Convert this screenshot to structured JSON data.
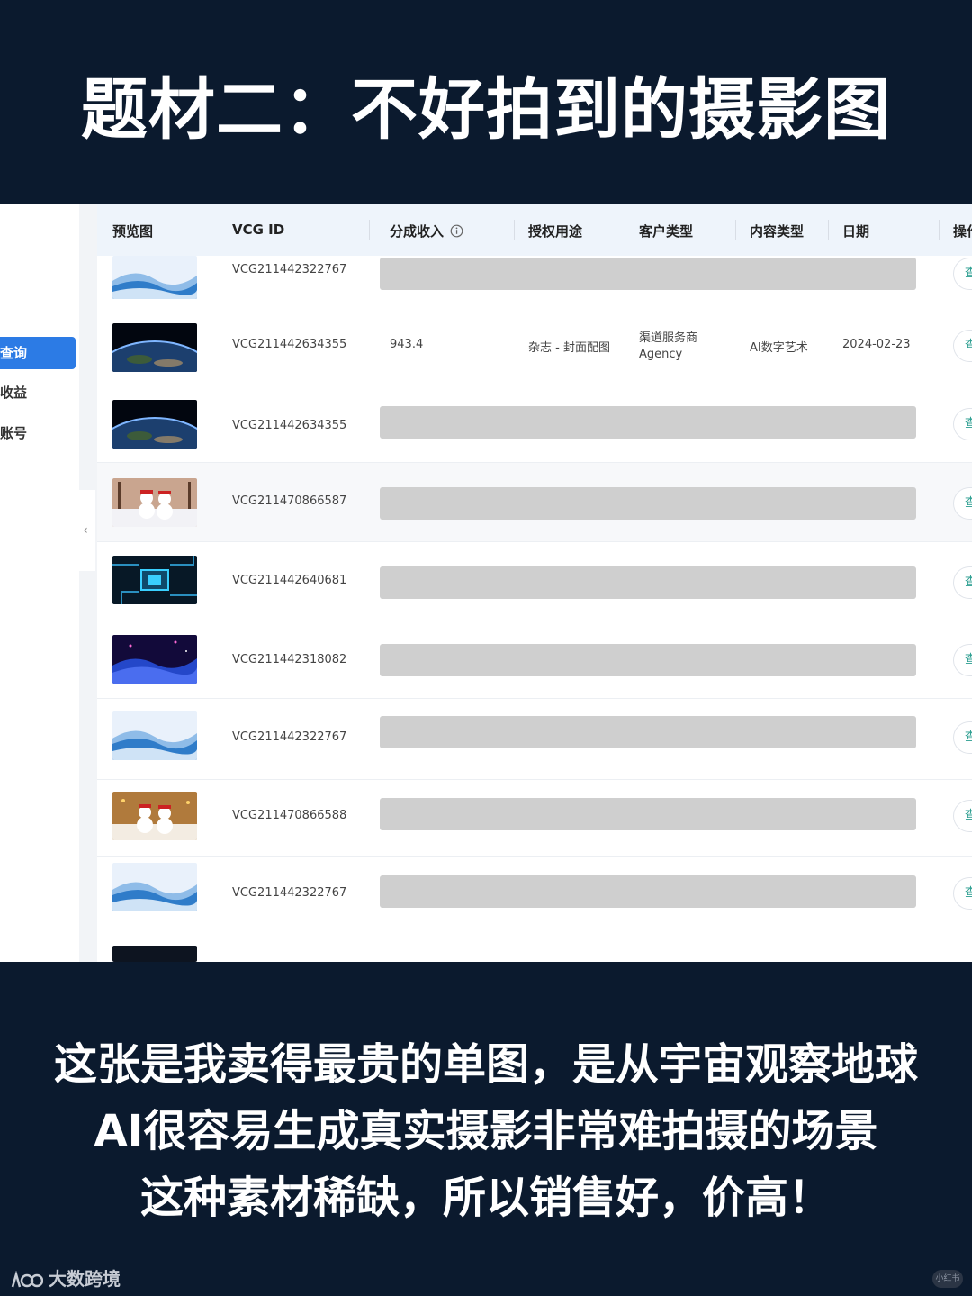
{
  "headline": "题材二：不好拍到的摄影图",
  "sidebar": {
    "items": [
      {
        "label": "查询",
        "active": true
      },
      {
        "label": "收益",
        "active": false
      },
      {
        "label": "账号",
        "active": false
      }
    ],
    "collapse_glyph": "‹"
  },
  "table": {
    "columns": [
      "预览图",
      "VCG ID",
      "分成收入",
      "授权用途",
      "客户类型",
      "内容类型",
      "日期",
      "操作"
    ],
    "info_icon": "info-icon",
    "rows": [
      {
        "thumb": "blue-wave",
        "vcg_id": "VCG211442322767",
        "redacted": true,
        "op": "查"
      },
      {
        "thumb": "earth-from-space",
        "vcg_id": "VCG211442634355",
        "redacted": false,
        "income": "943.4",
        "usage": "杂志 - 封面配图",
        "client_type_line1": "渠道服务商",
        "client_type_line2": "Agency",
        "content_type": "AI数字艺术",
        "date": "2024-02-23",
        "op": "查"
      },
      {
        "thumb": "earth-from-space",
        "vcg_id": "VCG211442634355",
        "redacted": true,
        "op": "查"
      },
      {
        "thumb": "snowmen",
        "vcg_id": "VCG211470866587",
        "redacted": true,
        "op": "查"
      },
      {
        "thumb": "circuit-board",
        "vcg_id": "VCG211442640681",
        "redacted": true,
        "op": "查"
      },
      {
        "thumb": "particle-wave",
        "vcg_id": "VCG211442318082",
        "redacted": true,
        "op": "查"
      },
      {
        "thumb": "blue-wave",
        "vcg_id": "VCG211442322767",
        "redacted": true,
        "op": "查"
      },
      {
        "thumb": "snowmen-warm",
        "vcg_id": "VCG211470866588",
        "redacted": true,
        "op": "查"
      },
      {
        "thumb": "blue-wave",
        "vcg_id": "VCG211442322767",
        "redacted": true,
        "op": "查"
      }
    ]
  },
  "caption": {
    "line1": "这张是我卖得最贵的单图，是从宇宙观察地球",
    "line2": "AI很容易生成真实摄影非常难拍摄的场景",
    "line3": "这种素材稀缺，所以销售好，价高！"
  },
  "watermark": {
    "text": "大数跨境",
    "logo_icon": "bigdata-logo-icon",
    "corner_label": "小红书"
  },
  "colors": {
    "background": "#0b1a2e",
    "accent": "#2c7be5",
    "redaction": "#cfcfcf",
    "header_row": "#eef4fb"
  }
}
